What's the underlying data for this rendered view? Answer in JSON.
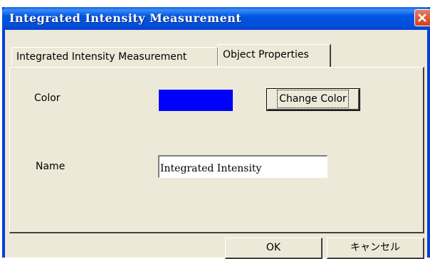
{
  "window": {
    "title": "Integrated Intensity Measurement"
  },
  "tabs": [
    {
      "label": "Integrated Intensity Measurement",
      "active": false
    },
    {
      "label": "Object Properties",
      "active": true
    }
  ],
  "properties": {
    "color_label": "Color",
    "color_value": "#0000ff",
    "change_color_label": "Change Color",
    "name_label": "Name",
    "name_value": "Integrated Intensity"
  },
  "footer": {
    "ok_label": "OK",
    "cancel_label": "キャンセル"
  },
  "colors": {
    "titlebar": "#0054e3",
    "face": "#ece9d8",
    "close_button": "#d1401d"
  }
}
